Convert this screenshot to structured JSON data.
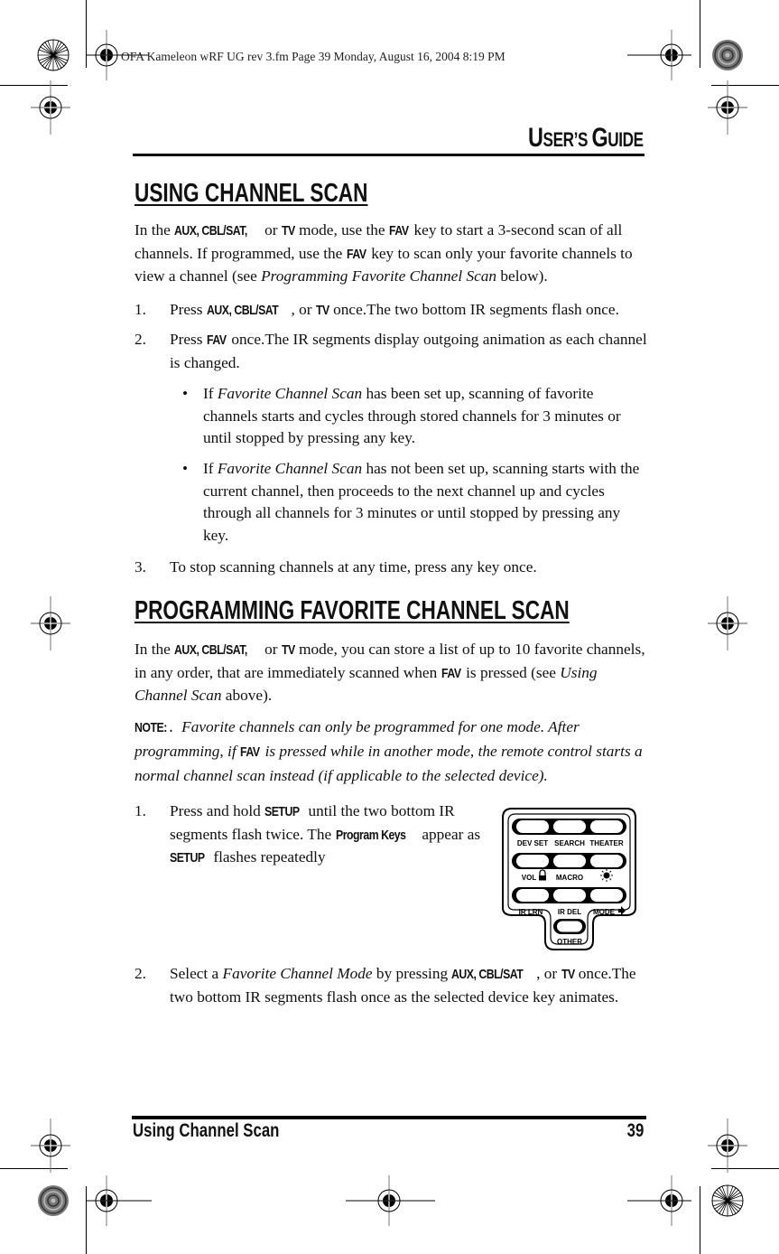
{
  "slug": "OFA Kameleon wRF UG rev 3.fm  Page 39  Monday, August 16, 2004  8:19 PM",
  "running_head": {
    "first1": "U",
    "rest1": "SER’S ",
    "first2": "G",
    "rest2": "UIDE"
  },
  "section1": {
    "title": "USING CHANNEL SCAN",
    "intro": {
      "t1": "In the ",
      "k1": "AUX, CBL/SAT,",
      "t2": " or ",
      "k2": "TV",
      "t3": " mode, use the ",
      "k3": "FAV",
      "t4": " key to start a 3-second scan of all channels. If programmed, use the ",
      "k4": "FAV",
      "t5": " key to scan only your favorite channels to view a channel (see ",
      "i1": "Programming Favorite Channel Scan",
      "t6": " below)."
    },
    "steps": [
      {
        "num": "1.",
        "t1": "Press ",
        "k1": "AUX, CBL/SAT",
        "t2": ", or ",
        "k2": "TV",
        "t3": " once.The two bottom IR segments flash once."
      },
      {
        "num": "2.",
        "t1": "Press ",
        "k1": "FAV",
        "t2": " once.The IR segments display outgoing animation as each channel is changed."
      },
      {
        "num": "3.",
        "t1": "To stop scanning channels at any time, press any key once."
      }
    ],
    "bullets": [
      {
        "dot": "•",
        "t1": "If ",
        "i1": "Favorite Channel Scan",
        "t2": "  has been set up, scanning of favorite channels starts and cycles through stored channels for 3 minutes or until stopped by pressing any key."
      },
      {
        "dot": "•",
        "t1": "If ",
        "i1": "Favorite Channel Scan",
        "t2": "  has not been set up, scanning starts with the current channel, then proceeds to the next channel up and cycles through all channels for 3 minutes or until stopped by pressing any key."
      }
    ]
  },
  "section2": {
    "title": "PROGRAMMING FAVORITE CHANNEL SCAN",
    "intro": {
      "t1": "In the ",
      "k1": "AUX, CBL/SAT,",
      "t2": " or ",
      "k2": "TV",
      "t3": " mode, you can store a list of up to 10 favorite channels, in any order, that are immediately scanned when ",
      "k3": "FAV",
      "t4": " is pressed (see ",
      "i1": "Using Channel Scan",
      "t5": " above)."
    },
    "note": {
      "label": "NOTE: .",
      "t1": " Favorite channels can only be programmed for one mode. After programming, if ",
      "k1": "FAV",
      "t2": " is pressed while in another mode, the remote control starts a normal channel scan instead (if applicable to the selected device)."
    },
    "steps": [
      {
        "num": "1.",
        "t1": "Press and hold ",
        "k1": "SETUP",
        "t2": " until the two bottom IR segments flash twice. The ",
        "k2": "Program Keys",
        "t3": " appear as ",
        "k3": "SETUP",
        "t4": " flashes repeatedly"
      },
      {
        "num": "2.",
        "t1": "Select a ",
        "i1": "Favorite Channel Mode",
        "t2": " by pressing ",
        "k1": "AUX, CBL/SAT",
        "t3": ", or ",
        "k2": "TV",
        "t4": " once.The two bottom IR segments flash once as the selected device key animates."
      }
    ]
  },
  "keypad": {
    "rows": [
      [
        "DEV SET",
        "SEARCH",
        "THEATER"
      ],
      [
        "VOL",
        "MACRO",
        ""
      ],
      [
        "IR LRN",
        "IR DEL",
        "MODE"
      ]
    ],
    "bottom": "OTHER",
    "icons": {
      "vol": "lock-icon",
      "row2_right": "light-icon",
      "mode": "arrow-right-icon"
    }
  },
  "footer": {
    "title": "Using Channel Scan",
    "page": "39"
  }
}
